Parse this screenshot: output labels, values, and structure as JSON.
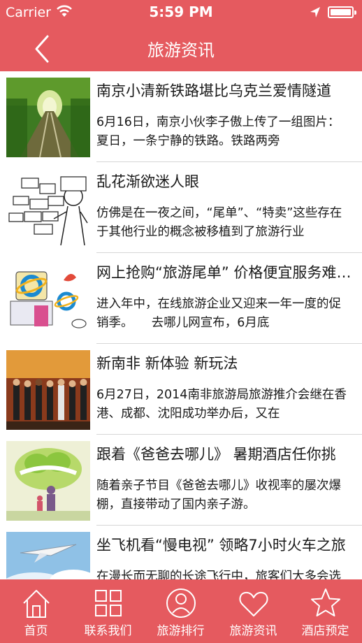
{
  "status": {
    "carrier": "Carrier",
    "time": "5:59 PM",
    "wifi_icon": "wifi-icon",
    "location_icon": "location-arrow-icon",
    "battery_icon": "battery-icon"
  },
  "nav": {
    "title": "旅游资讯",
    "back_icon": "chevron-left-icon"
  },
  "theme": {
    "accent": "#e55a5f",
    "divider": "#d6d6d6",
    "text": "#1a1a1a"
  },
  "articles": [
    {
      "title": "南京小清新铁路堪比乌克兰爱情隧道",
      "desc": "6月16日，南京小伙李子傲上传了一组图片：夏日，一条宁静的铁路。铁路两旁"
    },
    {
      "title": "乱花渐欲迷人眼",
      "desc": "仿佛是在一夜之间，“尾单”、“特卖”这些存在于其他行业的概念被移植到了旅游行业"
    },
    {
      "title": "网上抢购“旅游尾单” 价格便宜服务难保障",
      "desc": "进入年中，在线旅游企业又迎来一年一度的促销季。　　去哪儿网宣布，6月底"
    },
    {
      "title": "新南非 新体验 新玩法",
      "desc": "6月27日，2014南非旅游局旅游推介会继在香港、成都、沈阳成功举办后，又在"
    },
    {
      "title": "跟着《爸爸去哪儿》 暑期酒店任你挑",
      "desc": "随着亲子节目《爸爸去哪儿》收视率的屡次爆棚，直接带动了国内亲子游。"
    },
    {
      "title": "坐飞机看“慢电视” 领略7小时火车之旅",
      "desc": "在漫长而无聊的长途飞行中，旅客们大多会选择看电影打发时间"
    }
  ],
  "tabs": [
    {
      "label": "首页",
      "icon": "home-icon"
    },
    {
      "label": "联系我们",
      "icon": "grid-icon"
    },
    {
      "label": "旅游排行",
      "icon": "user-circle-icon"
    },
    {
      "label": "旅游资讯",
      "icon": "heart-icon"
    },
    {
      "label": "酒店预定",
      "icon": "star-icon"
    }
  ]
}
